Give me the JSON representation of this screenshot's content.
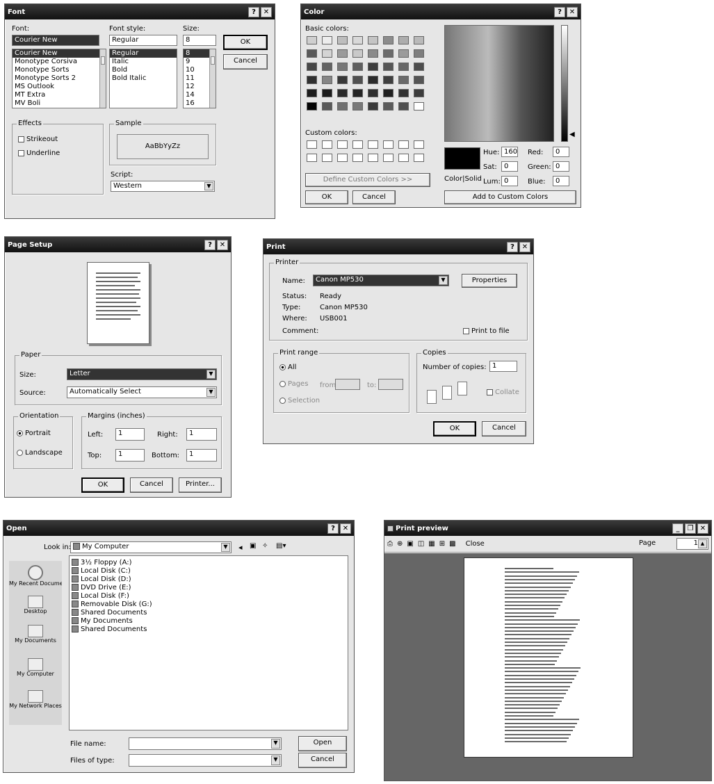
{
  "font_dialog": {
    "title": "Font",
    "font_label": "Font:",
    "font_value": "Courier New",
    "fonts": [
      "Courier New",
      "Monotype Corsiva",
      "Monotype Sorts",
      "Monotype Sorts 2",
      "MS Outlook",
      "MT Extra",
      "MV Boli"
    ],
    "style_label": "Font style:",
    "style_value": "Regular",
    "styles": [
      "Regular",
      "Italic",
      "Bold",
      "Bold Italic"
    ],
    "size_label": "Size:",
    "size_value": "8",
    "sizes": [
      "8",
      "9",
      "10",
      "11",
      "12",
      "14",
      "16"
    ],
    "ok": "OK",
    "cancel": "Cancel",
    "effects_label": "Effects",
    "strikeout": "Strikeout",
    "underline": "Underline",
    "sample_label": "Sample",
    "sample_text": "AaBbYyZz",
    "script_label": "Script:",
    "script_value": "Western"
  },
  "color_dialog": {
    "title": "Color",
    "basic_label": "Basic colors:",
    "custom_label": "Custom colors:",
    "define_btn": "Define Custom Colors >>",
    "ok": "OK",
    "cancel": "Cancel",
    "add_btn": "Add to Custom Colors",
    "colorsolid_label": "Color|Solid",
    "hue_label": "Hue:",
    "hue_value": "160",
    "sat_label": "Sat:",
    "sat_value": "0",
    "lum_label": "Lum:",
    "lum_value": "0",
    "red_label": "Red:",
    "red_value": "0",
    "green_label": "Green:",
    "green_value": "0",
    "blue_label": "Blue:",
    "blue_value": "0",
    "basic_swatches": [
      "#cfcfcf",
      "#ededed",
      "#bdbdbd",
      "#d8d8d8",
      "#c4c4c4",
      "#8c8c8c",
      "#adadad",
      "#b9b9b9",
      "#5a5a5a",
      "#d4d4d4",
      "#9a9a9a",
      "#c9c9c9",
      "#8a8a8a",
      "#6c6c6c",
      "#9b9b9b",
      "#7e7e7e",
      "#474747",
      "#636363",
      "#777777",
      "#5f5f5f",
      "#3e3e3e",
      "#565656",
      "#676767",
      "#4d4d4d",
      "#303030",
      "#868686",
      "#393939",
      "#505050",
      "#2b2b2b",
      "#3f3f3f",
      "#6a6a6a",
      "#555555",
      "#1d1d1d",
      "#1c1c1c",
      "#2a2a2a",
      "#242424",
      "#2e2e2e",
      "#202020",
      "#333333",
      "#3c3c3c",
      "#050505",
      "#595959",
      "#707070",
      "#787878",
      "#3a3a3a",
      "#5b5b5b",
      "#4f4f4f",
      "#ffffff"
    ]
  },
  "page_setup": {
    "title": "Page Setup",
    "paper_label": "Paper",
    "size_label": "Size:",
    "size_value": "Letter",
    "source_label": "Source:",
    "source_value": "Automatically Select",
    "orientation_label": "Orientation",
    "portrait": "Portrait",
    "landscape": "Landscape",
    "margins_label": "Margins (inches)",
    "left_label": "Left:",
    "left_value": "1",
    "right_label": "Right:",
    "right_value": "1",
    "top_label": "Top:",
    "top_value": "1",
    "bottom_label": "Bottom:",
    "bottom_value": "1",
    "ok": "OK",
    "cancel": "Cancel",
    "printer": "Printer..."
  },
  "print_dialog": {
    "title": "Print",
    "printer_group": "Printer",
    "name_label": "Name:",
    "name_value": "Canon MP530",
    "properties": "Properties",
    "status_label": "Status:",
    "status_value": "Ready",
    "type_label": "Type:",
    "type_value": "Canon MP530",
    "where_label": "Where:",
    "where_value": "USB001",
    "comment_label": "Comment:",
    "print_to_file": "Print to file",
    "range_group": "Print range",
    "all": "All",
    "pages": "Pages",
    "from": "from:",
    "to": "to:",
    "selection": "Selection",
    "copies_group": "Copies",
    "num_copies_label": "Number of copies:",
    "num_copies": "1",
    "collate": "Collate",
    "ok": "OK",
    "cancel": "Cancel"
  },
  "open_dialog": {
    "title": "Open",
    "lookin_label": "Look in:",
    "lookin_value": "My Computer",
    "places": [
      "My Recent Documents",
      "Desktop",
      "My Documents",
      "My Computer",
      "My Network Places"
    ],
    "items": [
      "3½ Floppy (A:)",
      "Local Disk (C:)",
      "Local Disk (D:)",
      "DVD Drive (E:)",
      "Local Disk (F:)",
      "Removable Disk (G:)",
      "Shared Documents",
      "My Documents",
      "Shared Documents"
    ],
    "filename_label": "File name:",
    "filetype_label": "Files of type:",
    "open": "Open",
    "cancel": "Cancel"
  },
  "print_preview": {
    "title": "Print preview",
    "close_label": "Close",
    "page_label": "Page",
    "page_value": "1"
  }
}
